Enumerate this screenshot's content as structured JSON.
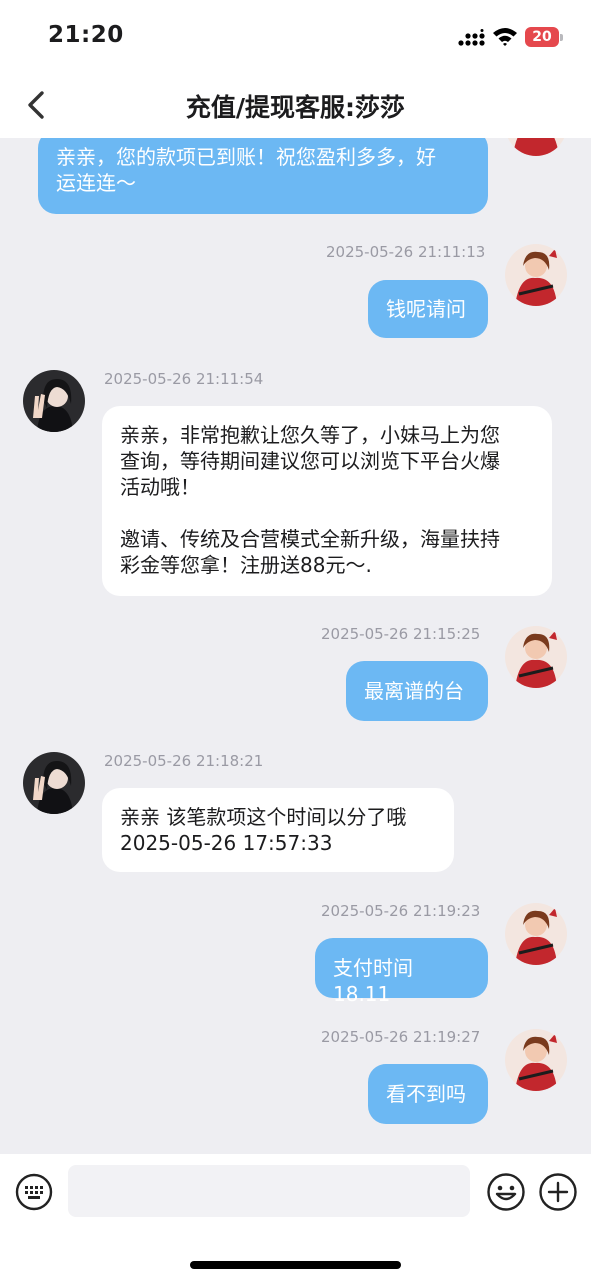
{
  "status_bar": {
    "time": "21:20",
    "battery_level": "20"
  },
  "header": {
    "title": "充值/提现客服:莎莎"
  },
  "messages": [
    {
      "direction": "incoming",
      "timestamp": "",
      "text": "亲亲，您的款项已到账！祝您盈利多多，好\n运连连～"
    },
    {
      "direction": "outgoing",
      "timestamp": "2025-05-26 21:11:13",
      "text": "钱呢请问"
    },
    {
      "direction": "incoming",
      "timestamp": "2025-05-26 21:11:54",
      "text": "亲亲，非常抱歉让您久等了，小妹马上为您\n查询，等待期间建议您可以浏览下平台火爆\n活动哦！\n\n邀请、传统及合营模式全新升级，海量扶持\n彩金等您拿！注册送88元～."
    },
    {
      "direction": "outgoing",
      "timestamp": "2025-05-26 21:15:25",
      "text": "最离谱的台"
    },
    {
      "direction": "incoming",
      "timestamp": "2025-05-26 21:18:21",
      "text": "亲亲 该笔款项这个时间以分了哦\n2025-05-26 17:57:33"
    },
    {
      "direction": "outgoing",
      "timestamp": "2025-05-26 21:19:23",
      "text": "支付时间18.11"
    },
    {
      "direction": "outgoing",
      "timestamp": "2025-05-26 21:19:27",
      "text": "看不到吗"
    }
  ],
  "input": {
    "placeholder": ""
  },
  "colors": {
    "outgoing_bubble": "#6cb8f3",
    "incoming_bubble": "#ffffff",
    "chat_background": "#eeeef2",
    "timestamp": "#9a9aa4"
  }
}
